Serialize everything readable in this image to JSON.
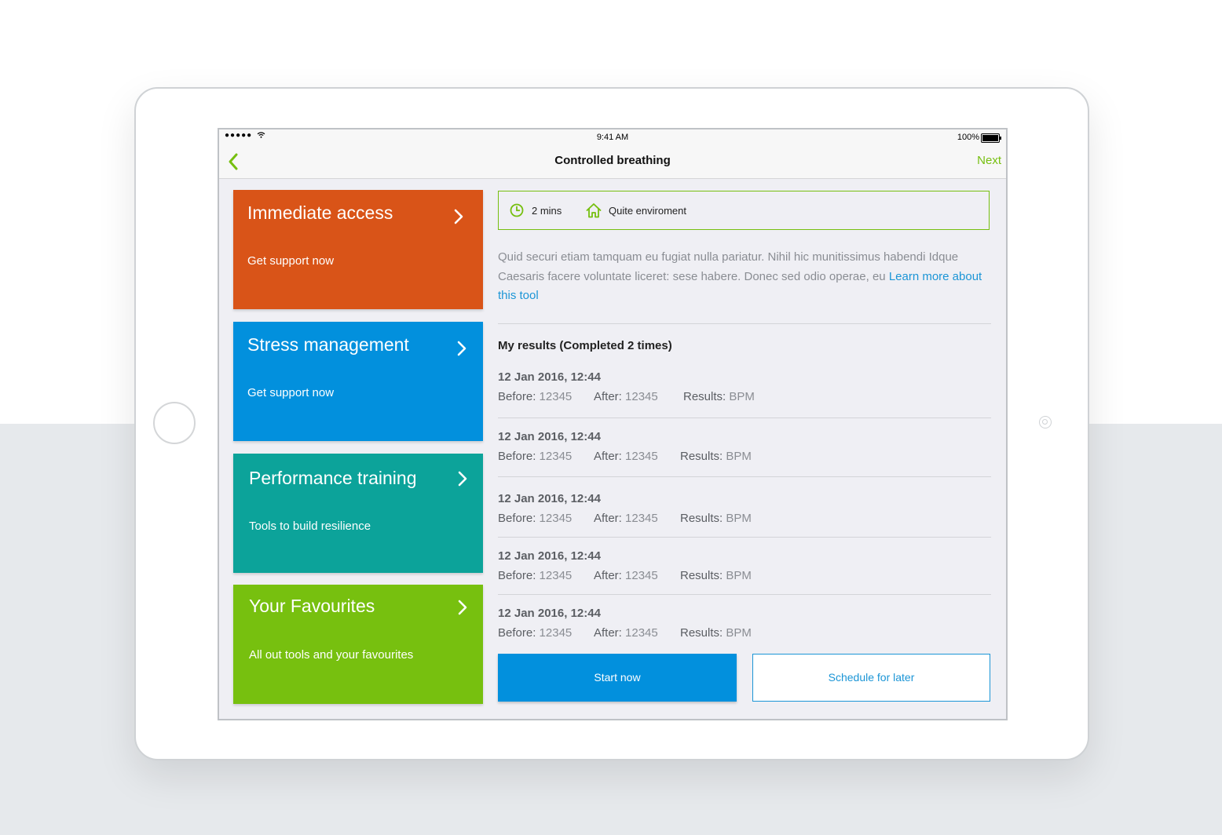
{
  "status_bar": {
    "signal": "●●●●●",
    "time": "9:41 AM",
    "battery": "100%"
  },
  "nav": {
    "title": "Controlled breathing",
    "next_label": "Next"
  },
  "tiles": [
    {
      "title": "Immediate access",
      "subtitle": "Get support now",
      "color": "#d95418"
    },
    {
      "title": "Stress management",
      "subtitle": "Get support now",
      "color": "#0290dd"
    },
    {
      "title": "Performance training",
      "subtitle": "Tools to build resilience",
      "color": "#0ca39a"
    },
    {
      "title": "Your Favourites",
      "subtitle": "All out tools and your favourites",
      "color": "#77c00f"
    }
  ],
  "info": {
    "duration": "2 mins",
    "environment": "Quite enviroment"
  },
  "description": {
    "text": "Quid securi etiam tamquam eu fugiat nulla pariatur. Nihil hic munitissimus habendi Idque Caesaris facere voluntate liceret: sese habere. Donec sed odio operae, eu ",
    "link": "Learn more about this tool"
  },
  "results": {
    "heading": "My results (Completed 2 times)",
    "before_label": "Before:",
    "after_label": "After:",
    "results_label": "Results:",
    "rows": [
      {
        "date": "12 Jan 2016, 12:44",
        "before": "12345",
        "after": "12345",
        "result": "BPM"
      },
      {
        "date": "12 Jan 2016, 12:44",
        "before": "12345",
        "after": "12345",
        "result": "BPM"
      },
      {
        "date": "12 Jan 2016, 12:44",
        "before": "12345",
        "after": "12345",
        "result": "BPM"
      },
      {
        "date": "12 Jan 2016, 12:44",
        "before": "12345",
        "after": "12345",
        "result": "BPM"
      },
      {
        "date": "12 Jan 2016, 12:44",
        "before": "12345",
        "after": "12345",
        "result": "BPM"
      }
    ]
  },
  "actions": {
    "start": "Start now",
    "schedule": "Schedule for later"
  },
  "colors": {
    "accent_green": "#76bf0f",
    "link_blue": "#1b95d6",
    "primary_button": "#0290dd"
  }
}
